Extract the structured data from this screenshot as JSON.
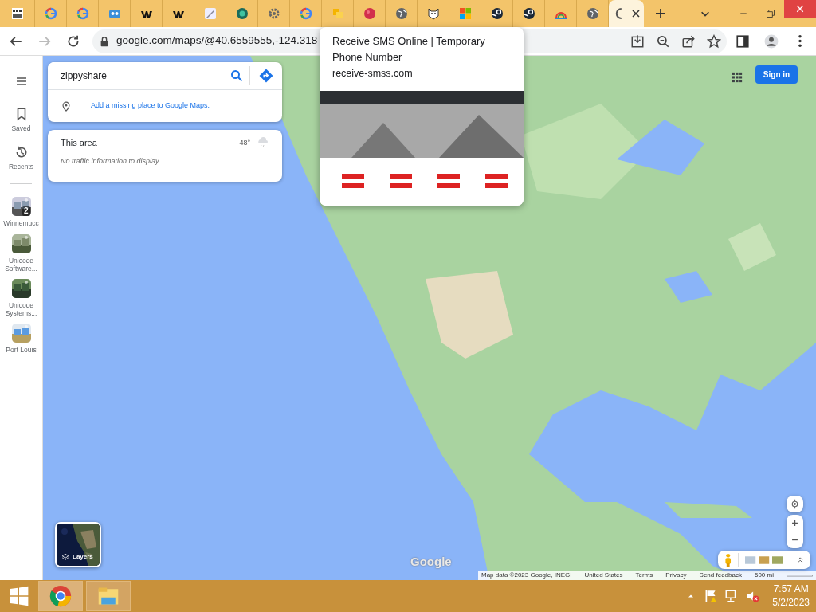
{
  "browser": {
    "tabs": [
      {
        "selected": false
      },
      {
        "selected": false
      },
      {
        "selected": false
      },
      {
        "selected": false
      },
      {
        "selected": false
      },
      {
        "selected": false
      },
      {
        "selected": false
      },
      {
        "selected": false
      },
      {
        "selected": false
      },
      {
        "selected": false
      },
      {
        "selected": false
      },
      {
        "selected": false
      },
      {
        "selected": false
      },
      {
        "selected": false
      },
      {
        "selected": false
      },
      {
        "selected": false
      },
      {
        "selected": false
      },
      {
        "selected": false
      },
      {
        "selected": false
      },
      {
        "selected": true
      }
    ],
    "address": {
      "url": "google.com/maps/@40.6559555,-124.318"
    },
    "hover_card": {
      "title": "Receive SMS Online | Temporary Phone Number",
      "domain": "receive-smss.com"
    }
  },
  "maps": {
    "sidebar": {
      "items": [
        {
          "label": "Saved"
        },
        {
          "label": "Recents"
        }
      ],
      "recent_places": [
        {
          "label": "Winnemucc",
          "count": "2"
        },
        {
          "label": "Unicode Software..."
        },
        {
          "label": "Unicode Systems..."
        },
        {
          "label": "Port Louis"
        }
      ]
    },
    "search": {
      "value": "zippyshare",
      "suggestion": "Add a missing place to Google Maps."
    },
    "area_card": {
      "title": "This area",
      "temperature": "48°",
      "message": "No traffic information to display"
    },
    "sign_in": "Sign in",
    "layers": "Layers",
    "logo": "Google",
    "footer": [
      "Map data ©2023 Google, INEGI",
      "United States",
      "Terms",
      "Privacy",
      "Send feedback"
    ],
    "scale": "500 mi"
  },
  "taskbar": {
    "apps": [
      {
        "kind": "browser",
        "selected": true
      },
      {
        "kind": "files",
        "selected": false
      }
    ],
    "time": "7:57 AM",
    "date": "5/2/2023"
  }
}
